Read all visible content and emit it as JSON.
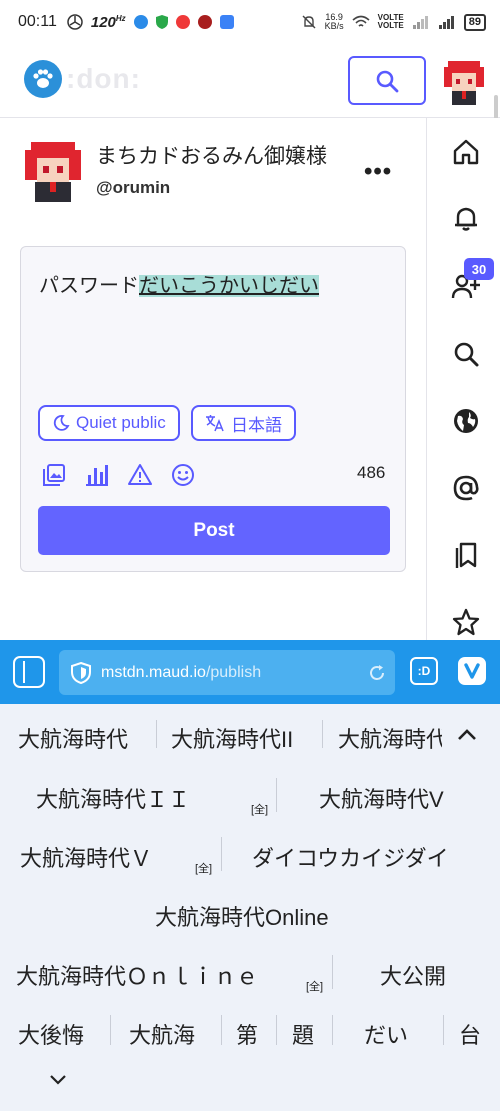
{
  "status_bar": {
    "time": "00:11",
    "refresh_rate": "120",
    "refresh_unit": "Hz",
    "speed_value": "16.9",
    "speed_unit": "KB/s",
    "volte1": "VOLTE",
    "volte2": "VOLTE",
    "battery": "89"
  },
  "header": {
    "logo_text": ":don:",
    "search_icon": "search-icon",
    "accent": "#595aff"
  },
  "account": {
    "display_name": "まちカドおるみん御嬢様",
    "username": "@orumin",
    "more": "•••"
  },
  "compose": {
    "text_plain": "パスワード",
    "text_highlighted": "だいこうかいじだい",
    "visibility_label": "Quiet public",
    "language_label": "日本語",
    "char_count": "486",
    "post_label": "Post",
    "toolbar_icons": [
      "image-icon",
      "poll-icon",
      "warning-icon",
      "emoji-icon"
    ]
  },
  "nav": {
    "icons": [
      "home-icon",
      "bell-icon",
      "follow-requests-icon",
      "search-icon",
      "globe-icon",
      "at-icon",
      "bookmarks-icon",
      "star-icon"
    ],
    "follow_requests_badge": "30"
  },
  "browser": {
    "url_host": "mstdn.maud.io",
    "url_path": "/publish",
    "ext_label": ":D"
  },
  "ime": {
    "row1": [
      "大航海時代",
      "大航海時代II",
      "大航海時代"
    ],
    "row2_a": "大航海時代ＩＩ",
    "row2_a_tag": "[全]",
    "row2_b": "大航海時代V",
    "row3_a": "大航海時代Ｖ",
    "row3_a_tag": "[全]",
    "row3_b": "ダイコウカイジダイ",
    "row4": "大航海時代Online",
    "row5_a": "大航海時代Ｏｎｌｉｎｅ",
    "row5_a_tag": "[全]",
    "row5_b": "大公開",
    "row6": [
      "大後悔",
      "大航海",
      "第",
      "題",
      "だい",
      "台"
    ]
  }
}
